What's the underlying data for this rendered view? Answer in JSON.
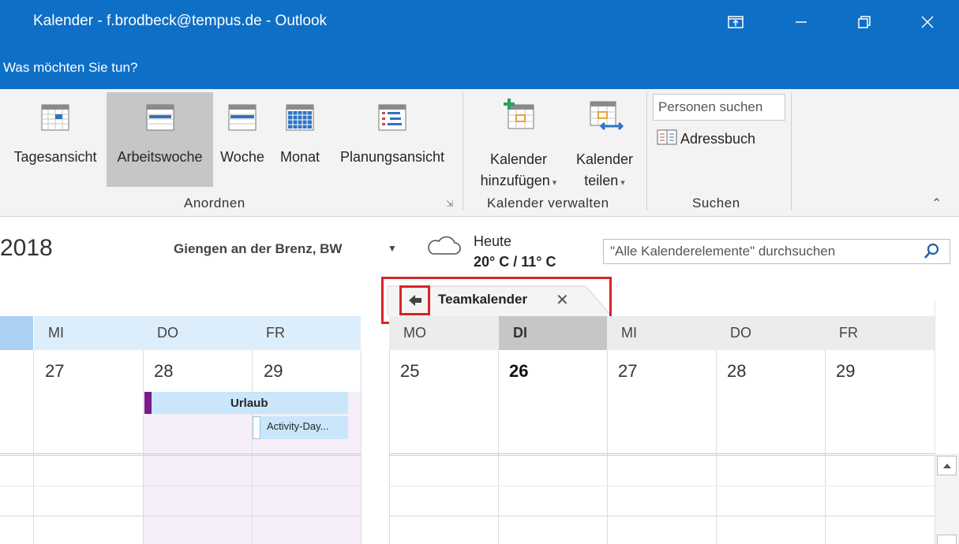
{
  "window": {
    "title": "Kalender - f.brodbeck@tempus.de  -  Outlook",
    "tell_me": "Was möchten Sie tun?"
  },
  "ribbon": {
    "arrange": {
      "buttons": [
        "Tagesansicht",
        "Arbeitswoche",
        "Woche",
        "Monat",
        "Planungsansicht"
      ],
      "group_label": "Anordnen"
    },
    "manage": {
      "add_line1": "Kalender",
      "add_line2": "hinzufügen",
      "share_line1": "Kalender",
      "share_line2": "teilen",
      "group_label": "Kalender verwalten"
    },
    "find": {
      "people_search": "Personen suchen",
      "address_book": "Adressbuch",
      "group_label": "Suchen"
    }
  },
  "nav": {
    "year": "2018",
    "location": "Giengen an der Brenz, BW",
    "weather_label": "Heute",
    "weather_temp": "20° C / 11° C",
    "search_placeholder": "\"Alle Kalenderelemente\" durchsuchen"
  },
  "tab": {
    "title": "Teamkalender",
    "close": "✕"
  },
  "left_calendar": {
    "days": [
      "MI",
      "DO",
      "FR"
    ],
    "dates": [
      "27",
      "28",
      "29"
    ],
    "events": {
      "urlaub": "Urlaub",
      "activity": "Activity-Day..."
    }
  },
  "right_calendar": {
    "days": [
      "MO",
      "DI",
      "MI",
      "DO",
      "FR"
    ],
    "dates": [
      "25",
      "26",
      "27",
      "28",
      "29"
    ]
  },
  "colors": {
    "brand": "#0e6fc6",
    "highlight": "#d6232a",
    "event": "#c9e6fa",
    "event_marker": "#7a1b8a"
  }
}
